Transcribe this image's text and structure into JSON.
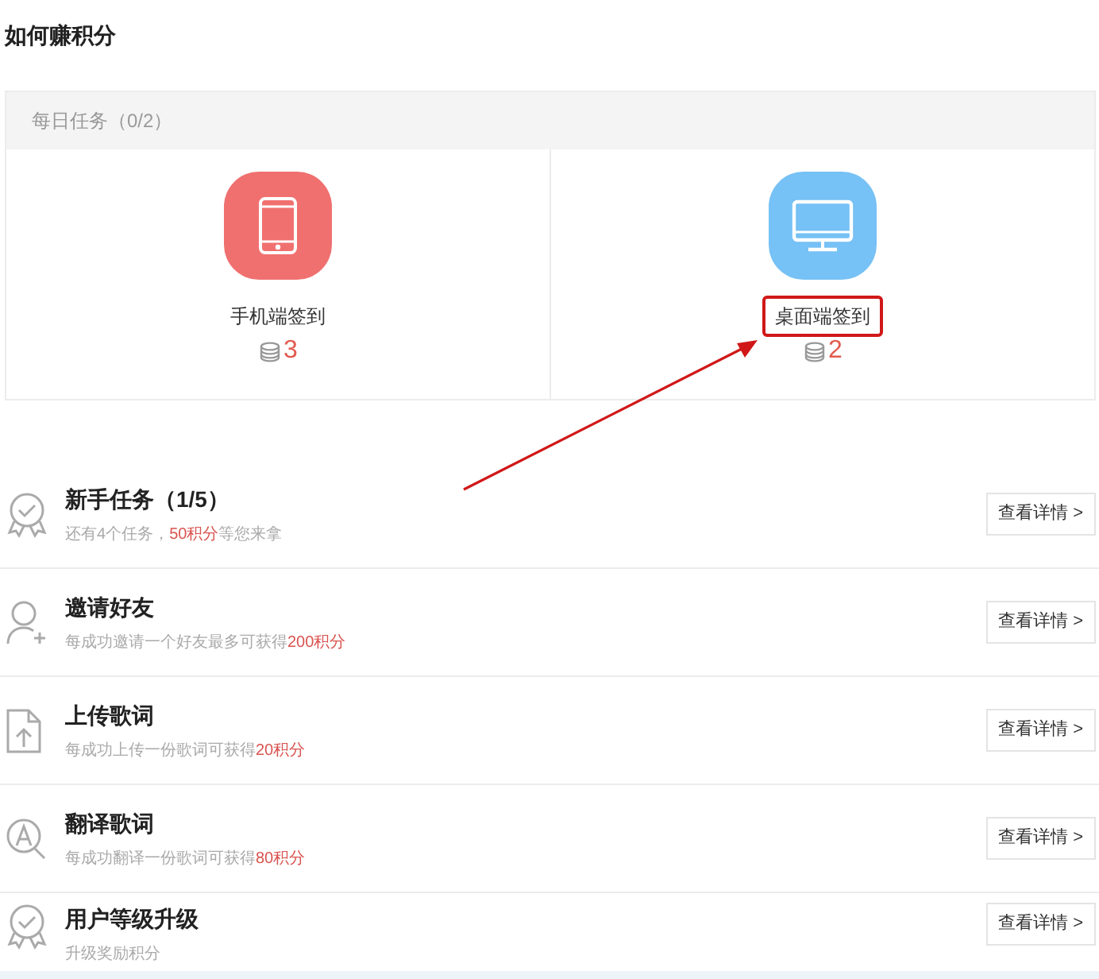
{
  "title": "如何赚积分",
  "daily": {
    "header": "每日任务（0/2）",
    "tasks": [
      {
        "kind": "mobile",
        "label": "手机端签到",
        "points": "3",
        "color": "#f07070",
        "annotated": false
      },
      {
        "kind": "desktop",
        "label": "桌面端签到",
        "points": "2",
        "color": "#76c1f5",
        "annotated": true
      }
    ]
  },
  "tasks": [
    {
      "kind": "badge",
      "title": "新手任务（1/5）",
      "subtitle": [
        {
          "text": "还有4个任务，",
          "highlight": false
        },
        {
          "text": "50积分",
          "highlight": true
        },
        {
          "text": "等您来拿",
          "highlight": false
        }
      ],
      "button": "查看详情 >"
    },
    {
      "kind": "invite",
      "title": "邀请好友",
      "subtitle": [
        {
          "text": "每成功邀请一个好友最多可获得",
          "highlight": false
        },
        {
          "text": "200积分",
          "highlight": true
        }
      ],
      "button": "查看详情 >"
    },
    {
      "kind": "upload",
      "title": "上传歌词",
      "subtitle": [
        {
          "text": "每成功上传一份歌词可获得",
          "highlight": false
        },
        {
          "text": "20积分",
          "highlight": true
        }
      ],
      "button": "查看详情 >"
    },
    {
      "kind": "translate",
      "title": "翻译歌词",
      "subtitle": [
        {
          "text": "每成功翻译一份歌词可获得",
          "highlight": false
        },
        {
          "text": "80积分",
          "highlight": true
        }
      ],
      "button": "查看详情 >"
    },
    {
      "kind": "badge",
      "title": "用户等级升级",
      "subtitle": [
        {
          "text": "升级奖励积分",
          "highlight": false
        }
      ],
      "button": "查看详情 >"
    }
  ]
}
